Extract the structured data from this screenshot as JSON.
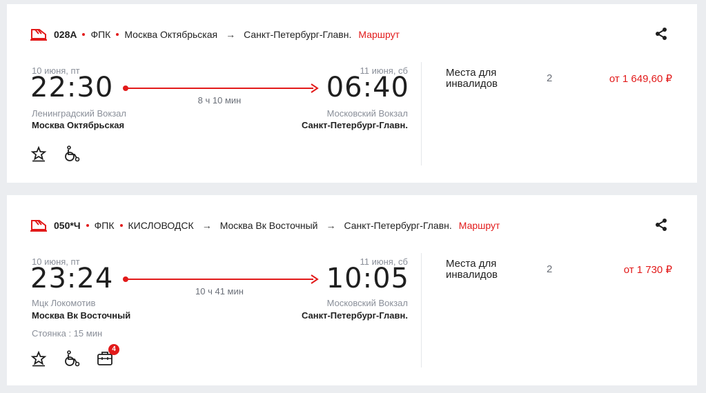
{
  "trains": [
    {
      "number": "028А",
      "carrier": "ФПК",
      "route": [
        "Москва Октябрьская",
        "Санкт-Петербург-Главн."
      ],
      "route_link": "Маршрут",
      "dep_date": "10 июня, пт",
      "dep_time": "22:30",
      "arr_date": "11 июня, сб",
      "arr_time": "06:40",
      "duration": "8 ч 10 мин",
      "dep_station": "Ленинградский Вокзал",
      "dep_city": "Москва Октябрьская",
      "arr_station": "Московский Вокзал",
      "arr_city": "Санкт-Петербург-Главн.",
      "stop": "",
      "icons": [
        "star-icon",
        "wheelchair-icon"
      ],
      "seat_type": "Места для инвалидов",
      "seat_count": "2",
      "price": "от 1 649,60 ₽"
    },
    {
      "number": "050*Ч",
      "carrier": "ФПК",
      "route": [
        "КИСЛОВОДСК",
        "Москва Вк Восточный",
        "Санкт-Петербург-Главн."
      ],
      "route_link": "Маршрут",
      "dep_date": "10 июня, пт",
      "dep_time": "23:24",
      "arr_date": "11 июня, сб",
      "arr_time": "10:05",
      "duration": "10 ч 41 мин",
      "dep_station": "Мцк Локомотив",
      "dep_city": "Москва Вк Восточный",
      "arr_station": "Московский Вокзал",
      "arr_city": "Санкт-Петербург-Главн.",
      "stop": "Стоянка : 15 мин",
      "icons": [
        "star-icon",
        "wheelchair-icon",
        "luggage-icon"
      ],
      "luggage_badge": "4",
      "seat_type": "Места для инвалидов",
      "seat_count": "2",
      "price": "от 1 730 ₽"
    }
  ],
  "colors": {
    "accent": "#e21a1a",
    "background": "#ebedf0",
    "card": "#ffffff"
  }
}
